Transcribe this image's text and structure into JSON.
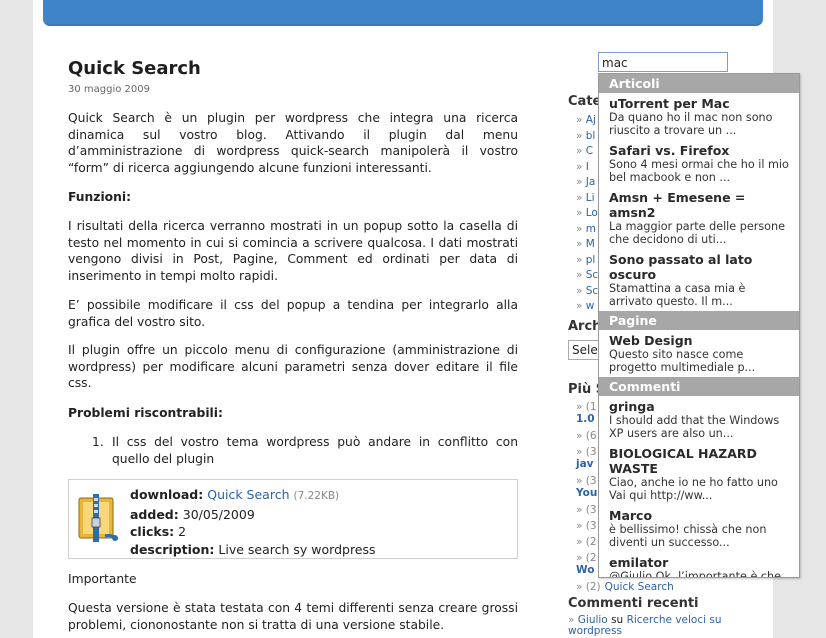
{
  "post": {
    "title": "Quick Search",
    "date": "30 maggio 2009",
    "intro": "Quick Search è un plugin per wordpress che integra una ricerca dinamica sul vostro blog. Attivando il plugin dal menu d’amministrazione di wordpress quick-search manipolerà il vostro “form” di ricerca aggiungendo alcune funzioni interessanti.",
    "funzioni_heading": "Funzioni:",
    "results_text": "I risultati della ricerca verranno mostrati in un popup sotto la casella di testo nel momento in cui si comincia a scrivere qualcosa. I dati mostrati vengono divisi in Post, Pagine, Comment ed ordinati per data di inserimento in tempi molto rapidi.",
    "css_text": "E’ possibile modificare il css del popup a tendina per integrarlo alla grafica del vostro sito.",
    "plugin_text": "Il plugin offre un piccolo menu di configurazione (amministrazione di wordpress) per modificare alcuni parametri senza dover editare il file css.",
    "problems_heading": "Problemi riscontrabili:",
    "problem_number": "1.",
    "problem_1": "Il css del vostro tema wordpress può andare in conflitto con quello del plugin",
    "download": {
      "download_label": "download:",
      "download_link": "Quick Search",
      "download_size": "(7.22KB)",
      "added_label": "added:",
      "added_value": "30/05/2009",
      "clicks_label": "clicks:",
      "clicks_value": "2",
      "description_label": "description:",
      "description_value": "Live search sy wordpress",
      "icon": "zip-archive-icon"
    },
    "importante": "Importante",
    "version_text": "Questa versione è stata testata con 4 temi differenti senza creare grossi problemi, ciononostante non si tratta di una versione stabile."
  },
  "sidebar": {
    "search_value": "mac",
    "categorie_heading": "Cate",
    "category_fragments": [
      "Aj",
      "bl",
      "C",
      "I",
      "Ja",
      "Li",
      "Lo",
      "m",
      "M",
      "pl",
      "Sc",
      "Sc",
      "w"
    ],
    "archivi_heading": "Arch",
    "archive_select": "Sele",
    "popular_heading": "Più S",
    "popular_fragments": [
      {
        "gray": "» (1",
        "link": "1.0"
      },
      {
        "gray": "» (6",
        "link": ""
      },
      {
        "gray": "» (3",
        "link": "jav"
      },
      {
        "gray": "» (3",
        "link": "You"
      },
      {
        "gray": "» (3",
        "link": ""
      },
      {
        "gray": "» (3",
        "link": ""
      },
      {
        "gray": "» (2",
        "link": ""
      },
      {
        "gray": "» (2",
        "link": "Wo"
      },
      {
        "gray": "» (2)",
        "link": "Quick Search"
      }
    ],
    "recent_comments_heading": "Commenti recenti",
    "recent_comment_author": "Giulio",
    "recent_comment_su": "su",
    "recent_comment_link": "Ricerche veloci su wordpress"
  },
  "popup": {
    "articoli_label": "Articoli",
    "articoli": [
      {
        "title": "uTorrent per Mac",
        "desc": "Da quano ho il mac non sono riuscito a trovare un ..."
      },
      {
        "title": "Safari vs. Firefox",
        "desc": "Sono 4 mesi ormai che ho il mio bel macbook e non ..."
      },
      {
        "title": "Amsn + Emesene = amsn2",
        "desc": "La maggior parte delle persone che decidono di uti..."
      },
      {
        "title": "Sono passato al lato oscuro",
        "desc": "Stamattina a casa mia è arrivato questo. Il m..."
      }
    ],
    "pagine_label": "Pagine",
    "pagine": [
      {
        "title": "Web Design",
        "desc": "Questo sito nasce come progetto multimediale p..."
      }
    ],
    "commenti_label": "Commenti",
    "commenti": [
      {
        "title": "gringa",
        "desc": "I should add that the Windows XP users are also un..."
      },
      {
        "title": "BIOLOGICAL HAZARD WASTE",
        "desc": "Ciao, anche io ne ho fatto uno Vai qui http://ww..."
      },
      {
        "title": "Marco",
        "desc": "è bellissimo! chissà che non diventi un successo..."
      },
      {
        "title": "emilator",
        "desc": "@Giulio Ok, l’importante è che tu sia a conoscen..."
      }
    ]
  },
  "colors": {
    "header_blue": "#3f84c8",
    "link_blue": "#2c62a8",
    "popup_section_gray": "#a7a7a7"
  }
}
